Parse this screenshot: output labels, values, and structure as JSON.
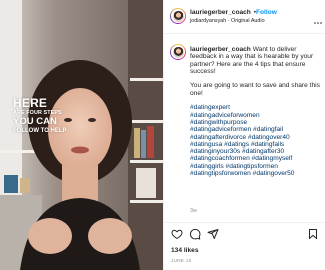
{
  "post": {
    "media": {
      "overlay": {
        "line1": "HERE",
        "line2": "ARE FOUR STEPS",
        "line3": "YOU CAN",
        "line4": "FOLLOW TO HELP"
      }
    },
    "header": {
      "username": "lauriegerber_coach",
      "separator": "•",
      "follow_label": "Follow",
      "audio": "jodiardyansyah · Original Audio",
      "more_icon": "more-horizontal-icon"
    },
    "caption": {
      "username": "lauriegerber_coach",
      "text": "Want to deliver feedback in a way that is hearable by your partner? Here are the 4 tips that ensure success!",
      "cta": "You are going to want to save and share this one!",
      "hashtags": [
        "#datingexpert",
        "#datingadviceforwomen",
        "#datingwithpurpose",
        "#datingadviceformen #datingfail",
        "#datingafterdivorce #datingover40",
        "#datingusa #datings #datingfails",
        "#datinginyour30s #datingafter30",
        "#datingcoachformen #datingmyself",
        "#datinggirls #datingtipsformen",
        "#datingtipsforwomen #datingover50"
      ],
      "time_ago": "3w"
    },
    "actions": {
      "like_icon": "heart-icon",
      "comment_icon": "comment-icon",
      "share_icon": "send-icon",
      "save_icon": "bookmark-icon"
    },
    "likes": "134 likes",
    "date": "JUNE 15",
    "colors": {
      "link_blue": "#0095f6",
      "hashtag": "#00376b",
      "muted": "#8e8e8e",
      "divider": "#efefef"
    }
  }
}
